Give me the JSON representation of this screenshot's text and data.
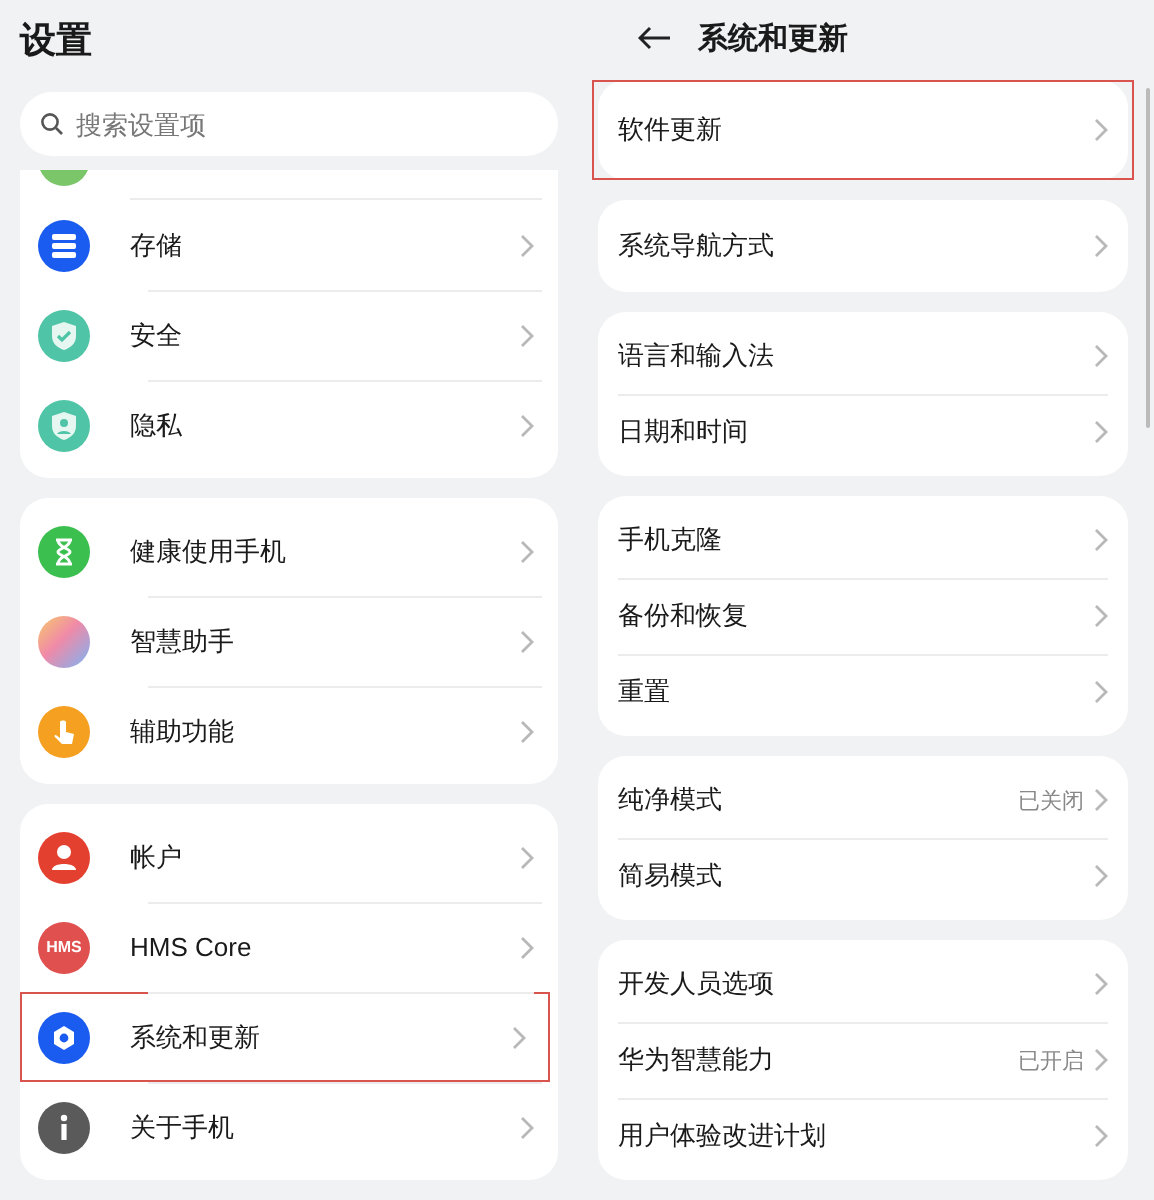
{
  "left": {
    "title": "设置",
    "search": {
      "placeholder": "搜索设置项"
    },
    "groups": [
      {
        "clipped_top": true,
        "items": [
          {
            "label": "存储",
            "kind": "storage",
            "highlighted": false
          },
          {
            "label": "安全",
            "kind": "security",
            "highlighted": false
          },
          {
            "label": "隐私",
            "kind": "privacy",
            "highlighted": false
          }
        ]
      },
      {
        "clipped_top": false,
        "items": [
          {
            "label": "健康使用手机",
            "kind": "hourglass",
            "highlighted": false
          },
          {
            "label": "智慧助手",
            "kind": "assistant",
            "highlighted": false
          },
          {
            "label": "辅助功能",
            "kind": "accessibility",
            "highlighted": false
          }
        ]
      },
      {
        "clipped_top": false,
        "items": [
          {
            "label": "帐户",
            "kind": "account",
            "highlighted": false
          },
          {
            "label": "HMS Core",
            "kind": "hms",
            "icon_text": "HMS",
            "highlighted": false
          },
          {
            "label": "系统和更新",
            "kind": "system",
            "highlighted": true
          },
          {
            "label": "关于手机",
            "kind": "about",
            "highlighted": false
          }
        ]
      }
    ]
  },
  "right": {
    "title": "系统和更新",
    "groups": [
      {
        "items": [
          {
            "label": "软件更新",
            "highlighted": true
          }
        ]
      },
      {
        "items": [
          {
            "label": "系统导航方式",
            "highlighted": false
          }
        ]
      },
      {
        "items": [
          {
            "label": "语言和输入法",
            "highlighted": false
          },
          {
            "label": "日期和时间",
            "highlighted": false
          }
        ]
      },
      {
        "items": [
          {
            "label": "手机克隆",
            "highlighted": false
          },
          {
            "label": "备份和恢复",
            "highlighted": false
          },
          {
            "label": "重置",
            "highlighted": false
          }
        ]
      },
      {
        "items": [
          {
            "label": "纯净模式",
            "value": "已关闭",
            "highlighted": false
          },
          {
            "label": "简易模式",
            "highlighted": false
          }
        ]
      },
      {
        "items": [
          {
            "label": "开发人员选项",
            "highlighted": false
          },
          {
            "label": "华为智慧能力",
            "value": "已开启",
            "highlighted": false
          },
          {
            "label": "用户体验改进计划",
            "highlighted": false
          }
        ]
      }
    ]
  }
}
